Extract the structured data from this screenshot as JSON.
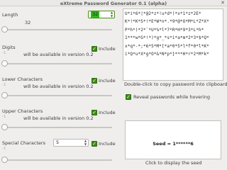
{
  "window": {
    "title": "eXtreme Password Generator 0.1 (alpha)",
    "close_glyph": "✕"
  },
  "length": {
    "label": "Length",
    "value": "32",
    "slider_value": "32"
  },
  "digits": {
    "label": "Digits",
    "include_label": "Include",
    "note": "will be available in version 0.2",
    "min_value": "-1"
  },
  "lower": {
    "label": "Lower Characters",
    "include_label": "Include",
    "note": "will be available in version 0.2",
    "min_value": "-1"
  },
  "upper": {
    "label": "Upper Characters",
    "include_label": "Include",
    "note": "will be available in version 0.2",
    "min_value": "-1"
  },
  "special": {
    "label": "Special Characters",
    "value": "5",
    "include_label": "Include",
    "min_value": "-1"
  },
  "passwords": [
    "U*i*6*|*@2*z*!u*d*)*x*1*z*2E*",
    "K*!*K*5*!*E*W*n*.*9*@*O*M*L*Z*X*",
    "P*h*)*2*`*U*%*l*7*R*H*9*3*L*h*",
    "1***w*G*!*)*g*_*s*i*a*m*2*3*$*Q*",
    "x*q*-*;*6*5*M*[*a*0*5*l*f*0*l*K*",
    "i*Q*u*X*g*O*&*N*p*}***H*r*2*M*k*"
  ],
  "copy_hint": "Double-click to copy password into clipboard",
  "reveal": {
    "label": "Reveal passwords while hovering",
    "checked": true
  },
  "seed": {
    "text": "Seed = 1******6"
  },
  "seed_hint": "Click to display the seed",
  "include_checked": true,
  "accent_color": "#3c8a14",
  "highlight_color": "#2fb818"
}
